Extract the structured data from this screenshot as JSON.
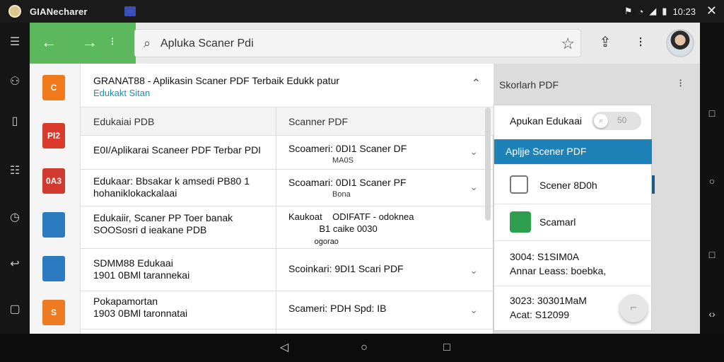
{
  "status_bar": {
    "app_name": "GIANecharer",
    "time": "10:23"
  },
  "toolbar": {
    "search_value": "Apluka Scaner Pdi"
  },
  "main_panel": {
    "title": "GRANAT88 - Aplikasin Scaner PDF Terbaik Edukk patur",
    "subtitle": "Edukakt Sitan",
    "columns": [
      "Edukaiai PDB",
      "Scanner PDF"
    ],
    "rows": [
      {
        "c1": [
          "E0I/Aplikarai Scaneer PDF Terbar PDI"
        ],
        "c2": [
          "Scoameri:  0DI1  Scaner DF"
        ],
        "c2_sub": "MA0S"
      },
      {
        "c1": [
          "Edukaar: Bbsakar k amsedi PB80 1",
          "hohaniklokackalaai"
        ],
        "c2": [
          "Scoamari:  0DI1  Scaner PF"
        ],
        "c2_sub": "Bona"
      },
      {
        "c1": [
          "Edukaiir, Scaner PP Toer banak",
          "SOOSosri d ieakane PDB"
        ],
        "c2": [
          "Kaukoat    ODIFATF - odoknea",
          "            B1 caike 0030",
          "            ogorao"
        ],
        "c2_sub": ""
      },
      {
        "c1": [
          "SDMM88 Edukaai",
          "1901 0BMl tarannekai"
        ],
        "c2": [
          "Scoinkari:  9DI1  Scari PDF"
        ],
        "c2_sub": ""
      },
      {
        "c1": [
          "Pokapamortan",
          "1903 0BMl taronnatai"
        ],
        "c2": [
          "Scameri:  PDH  Spd: IB"
        ],
        "c2_sub": ""
      }
    ]
  },
  "right_panel": {
    "title": "Skorlarh PDF",
    "toggle_label": "Apukan Edukaai",
    "toggle_value": "50",
    "items": [
      {
        "label": "Apljje Scener PDF",
        "selected": true
      },
      {
        "label": "Scener 8D0h",
        "selected": false
      },
      {
        "label": "Scamarl",
        "selected": false
      }
    ],
    "info1": [
      "3004: S1SIM0A",
      "Annar Leass: boebka,"
    ],
    "info2": [
      "3023: 30301MaM",
      "Acat: S12099"
    ]
  },
  "icons": {
    "file_colors": [
      "#f07a1c",
      "#d93a2c",
      "#d33a2f",
      "#2b7bc1",
      "#2b7bc1",
      "#ee7a22"
    ],
    "file_labels": [
      "C",
      "Pl2",
      "0A3",
      "",
      "",
      "S"
    ]
  }
}
